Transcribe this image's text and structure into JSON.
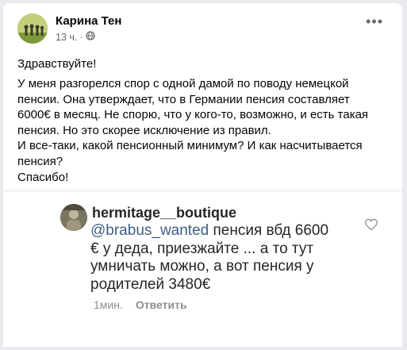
{
  "post": {
    "author": "Карина Тен",
    "time": "13 ч.",
    "separator": "·",
    "privacy_icon": "globe-icon",
    "more_icon": "more-horizontal-icon",
    "greeting": "Здравствуйте!",
    "body_lines": [
      "У меня разгорелся спор с одной дамой по поводу немецкой",
      "пенсии. Она утверждает, что в Германии пенсия составляет",
      "6000€ в месяц. Не спорю, что у кого-то, возможно, и есть такая",
      "пенсия. Но это скорее исключение из правил.",
      "И все-таки, какой пенсионный минимум? И как насчитывается",
      "пенсия?"
    ],
    "closing": "Спасибо!"
  },
  "comment": {
    "username": "hermitage__boutique",
    "mention": "@brabus_wanted",
    "text_lines_after_mention": " пенсия вбд  6600",
    "text_lines": [
      "€ у деда, приезжайте ... а то тут",
      "умничать можно, а вот пенсия у",
      "родителей 3480€"
    ],
    "time": "1мин.",
    "reply_label": "Ответить",
    "heart_icon": "heart-outline-icon"
  }
}
